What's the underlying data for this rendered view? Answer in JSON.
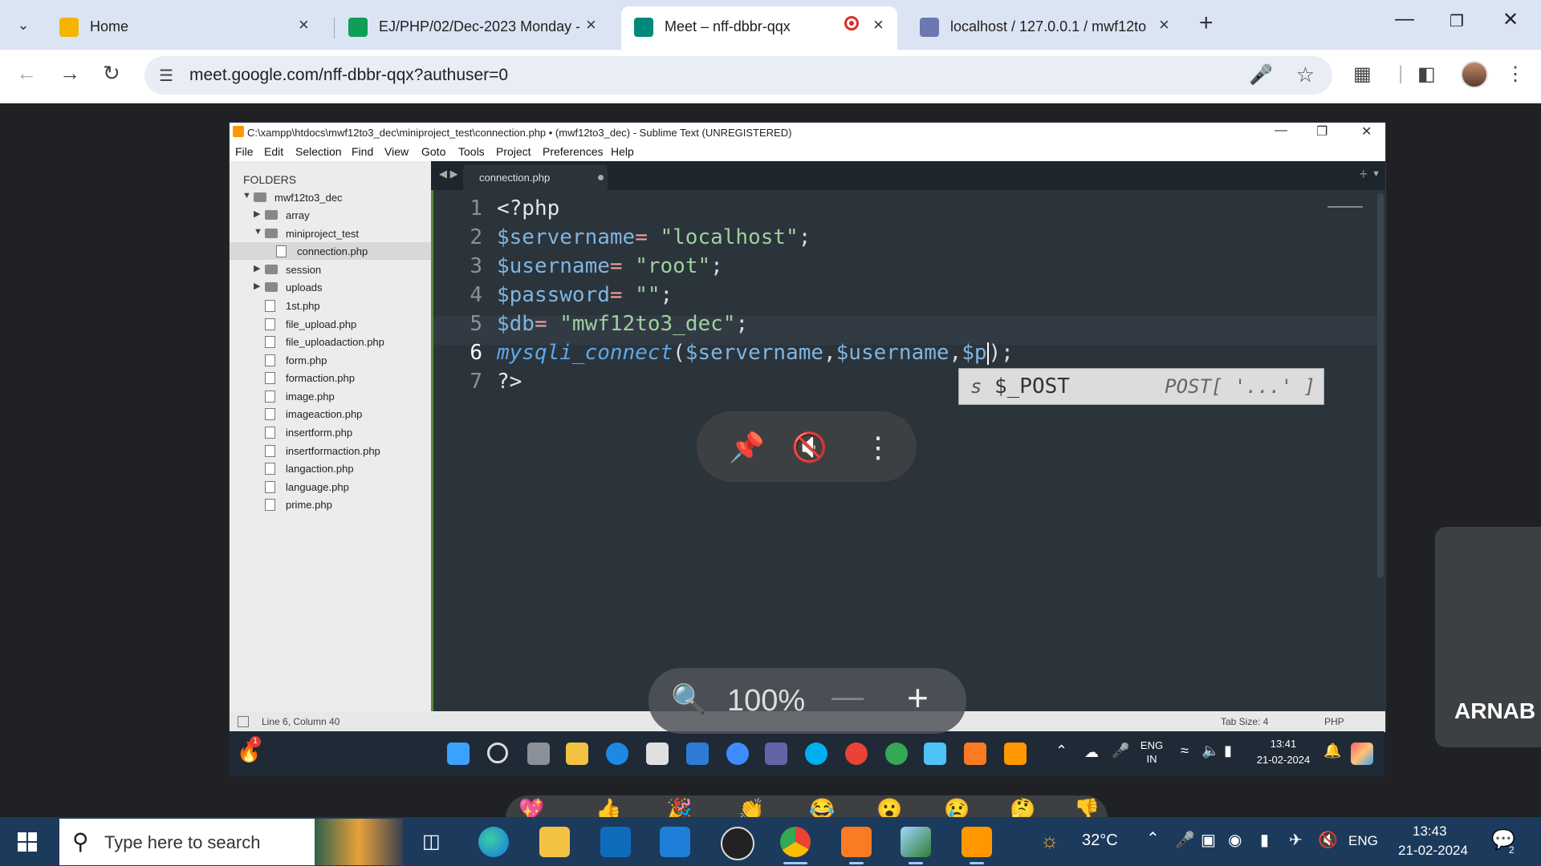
{
  "browser": {
    "tabs": [
      {
        "title": "Home",
        "color": "#f5b400"
      },
      {
        "title": "EJ/PHP/02/Dec-2023 Monday -",
        "color": "#0f9d58"
      },
      {
        "title": "Meet – nff-dbbr-qqx",
        "color": "#00897b"
      },
      {
        "title": "localhost / 127.0.0.1 / mwf12to",
        "color": "#6c78af"
      }
    ],
    "url": "meet.google.com/nff-dbbr-qqx?authuser=0"
  },
  "sublime": {
    "title": "C:\\xampp\\htdocs\\mwf12to3_dec\\miniproject_test\\connection.php • (mwf12to3_dec) - Sublime Text (UNREGISTERED)",
    "menu": [
      "File",
      "Edit",
      "Selection",
      "Find",
      "View",
      "Goto",
      "Tools",
      "Project",
      "Preferences",
      "Help"
    ],
    "sidebar": {
      "header": "FOLDERS",
      "items": [
        "mwf12to3_dec",
        "array",
        "miniproject_test",
        "connection.php",
        "session",
        "uploads",
        "1st.php",
        "file_upload.php",
        "file_uploadaction.php",
        "form.php",
        "formaction.php",
        "image.php",
        "imageaction.php",
        "insertform.php",
        "insertformaction.php",
        "langaction.php",
        "language.php",
        "prime.php"
      ]
    },
    "tab": "connection.php",
    "line_numbers": [
      "1",
      "2",
      "3",
      "4",
      "5",
      "6",
      "7"
    ],
    "code": {
      "l1": "<?php",
      "l2_var": "$servername",
      "l2_eq": "= ",
      "l2_str": "\"localhost\"",
      "l2_end": ";",
      "l3_var": "$username",
      "l3_eq": "= ",
      "l3_str": "\"root\"",
      "l3_end": ";",
      "l4_var": "$password",
      "l4_eq": "= ",
      "l4_str": "\"\"",
      "l4_end": ";",
      "l5_var": "$db",
      "l5_eq": "= ",
      "l5_str": "\"mwf12to3_dec\"",
      "l5_end": ";",
      "l6_fn": "mysqli_connect",
      "l6_open": "(",
      "l6_a1": "$servername",
      "l6_c1": ",",
      "l6_a2": "$username",
      "l6_c2": ",",
      "l6_a3": "$p",
      "l6_close": ");",
      "l7": "?>"
    },
    "autocomplete": {
      "kind": "s",
      "name": "$_POST",
      "hint": "POST[ '...' ]"
    },
    "status": {
      "position": "Line 6, Column 40",
      "tab_size": "Tab Size: 4",
      "syntax": "PHP"
    }
  },
  "inner_tray": {
    "lang": "ENG",
    "region": "IN",
    "time": "13:41",
    "date": "21-02-2024",
    "badge": "1"
  },
  "meet": {
    "zoom": "100%",
    "participant": "ARNAB"
  },
  "taskbar": {
    "search_placeholder": "Type here to search",
    "weather": "32°C",
    "lang": "ENG",
    "time": "13:43",
    "date": "21-02-2024",
    "notif_count": "2"
  }
}
